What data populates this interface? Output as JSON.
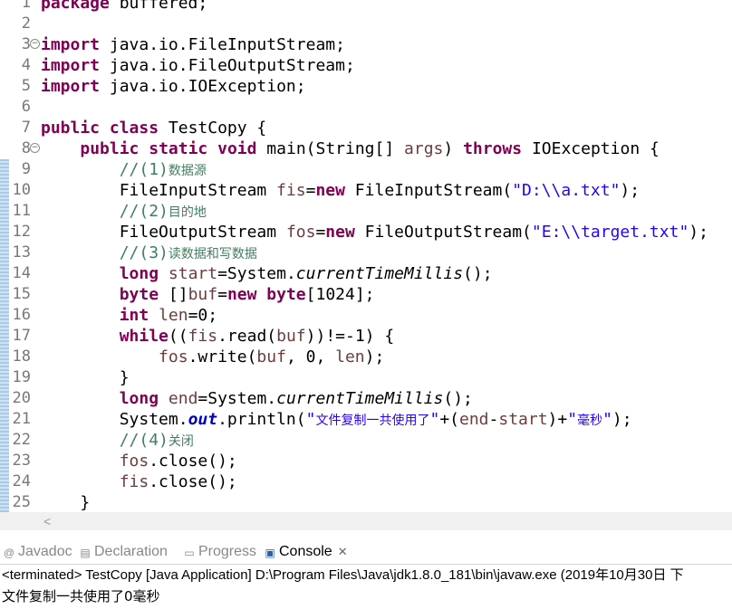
{
  "editor": {
    "lines": [
      {
        "n": "1",
        "t": "package buffered;"
      },
      {
        "n": "2",
        "t": ""
      },
      {
        "n": "3",
        "t": "import java.io.FileInputStream;"
      },
      {
        "n": "4",
        "t": "import java.io.FileOutputStream;"
      },
      {
        "n": "5",
        "t": "import java.io.IOException;"
      },
      {
        "n": "6",
        "t": ""
      },
      {
        "n": "7",
        "t": "public class TestCopy {"
      },
      {
        "n": "8",
        "t": "    public static void main(String[] args) throws IOException {"
      },
      {
        "n": "9",
        "t": "        //(1)数据源"
      },
      {
        "n": "10",
        "t": "        FileInputStream fis=new FileInputStream(\"D:\\\\a.txt\");"
      },
      {
        "n": "11",
        "t": "        //(2)目的地"
      },
      {
        "n": "12",
        "t": "        FileOutputStream fos=new FileOutputStream(\"E:\\\\target.txt\");"
      },
      {
        "n": "13",
        "t": "        //(3)读数据和写数据"
      },
      {
        "n": "14",
        "t": "        long start=System.currentTimeMillis();"
      },
      {
        "n": "15",
        "t": "        byte []buf=new byte[1024];"
      },
      {
        "n": "16",
        "t": "        int len=0;"
      },
      {
        "n": "17",
        "t": "        while((fis.read(buf))!=-1) {"
      },
      {
        "n": "18",
        "t": "            fos.write(buf, 0, len);"
      },
      {
        "n": "19",
        "t": "        }"
      },
      {
        "n": "20",
        "t": "        long end=System.currentTimeMillis();"
      },
      {
        "n": "21",
        "t": "        System.out.println(\"文件复制一共使用了\"+(end-start)+\"毫秒\");"
      },
      {
        "n": "22",
        "t": "        //(4)关闭"
      },
      {
        "n": "23",
        "t": "        fos.close();"
      },
      {
        "n": "24",
        "t": "        fis.close();"
      },
      {
        "n": "25",
        "t": "    }"
      }
    ],
    "fold_markers": [
      "3",
      "8"
    ]
  },
  "views": {
    "tabs": [
      {
        "id": "javadoc",
        "label": "Javadoc",
        "icon": "javadoc-icon",
        "active": false
      },
      {
        "id": "declaration",
        "label": "Declaration",
        "icon": "declaration-icon",
        "active": false
      },
      {
        "id": "progress",
        "label": "Progress",
        "icon": "progress-icon",
        "active": false
      },
      {
        "id": "console",
        "label": "Console",
        "icon": "console-icon",
        "active": true
      }
    ],
    "close_glyph": "✕"
  },
  "console": {
    "header": "<terminated> TestCopy [Java Application] D:\\Program Files\\Java\\jdk1.8.0_181\\bin\\javaw.exe (2019年10月30日 下",
    "output": "文件复制一共使用了0毫秒"
  }
}
